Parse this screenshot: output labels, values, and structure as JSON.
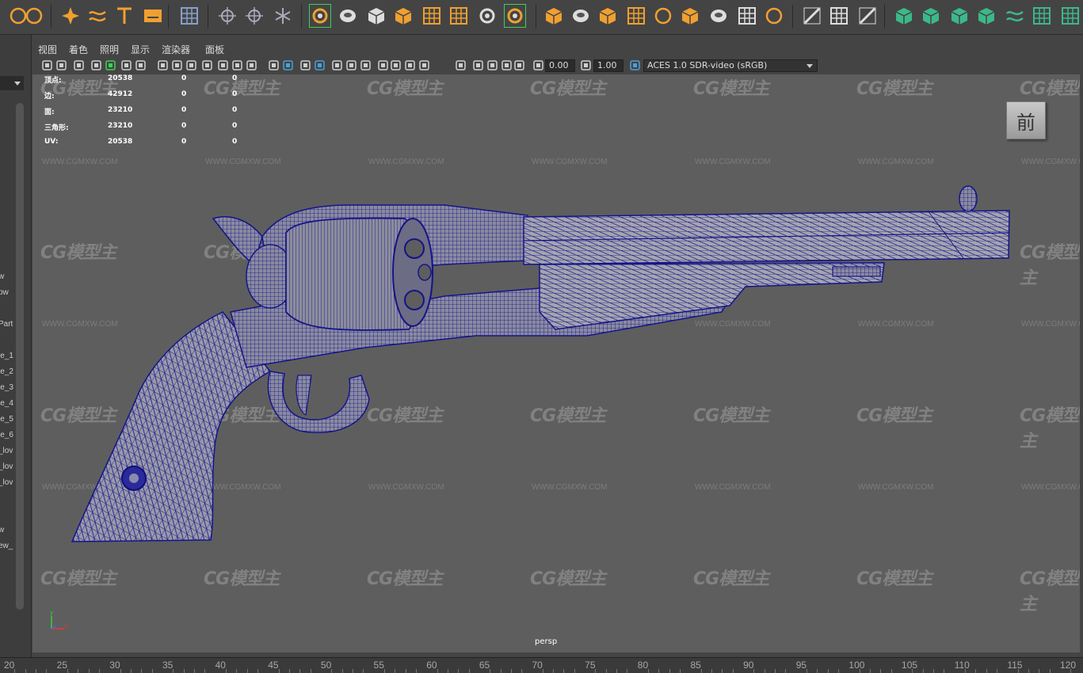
{
  "menubar": {
    "items": [
      "视图",
      "着色",
      "照明",
      "显示",
      "渲染器",
      "面板"
    ]
  },
  "toolbar": {
    "exposure_value": "0.00",
    "gamma_value": "1.00",
    "color_space": "ACES 1.0 SDR-video (sRGB)"
  },
  "hud": {
    "rows": [
      {
        "label": "顶点:",
        "value": "20538",
        "a": "0",
        "b": "0"
      },
      {
        "label": "边:",
        "value": "42912",
        "a": "0",
        "b": "0"
      },
      {
        "label": "面:",
        "value": "23210",
        "a": "0",
        "b": "0"
      },
      {
        "label": "三角形:",
        "value": "23210",
        "a": "0",
        "b": "0"
      },
      {
        "label": "UV:",
        "value": "20538",
        "a": "0",
        "b": "0"
      }
    ]
  },
  "viewcube": {
    "label": "前"
  },
  "camera": {
    "name": "persp"
  },
  "watermark": {
    "logo": "CG模型主",
    "url": "WWW.CGMXW.COM"
  },
  "outliner": {
    "items": [
      "w",
      "ow",
      "Part",
      "le_1",
      "le_2",
      "le_3",
      "le_4",
      "le_5",
      "le_6",
      "_lov",
      "_lov",
      "_lov",
      "w",
      "ew_"
    ]
  },
  "timeline": {
    "ticks": [
      "20",
      "25",
      "30",
      "35",
      "40",
      "45",
      "50",
      "55",
      "60",
      "65",
      "70",
      "75",
      "80",
      "85",
      "90",
      "95",
      "100",
      "105",
      "110",
      "115",
      "120"
    ]
  },
  "colors": {
    "accent_green": "#3bd15a",
    "wire": "#1a1a8c",
    "mesh": "#9a9aa6",
    "viewport_bg": "#5e5e5e"
  }
}
